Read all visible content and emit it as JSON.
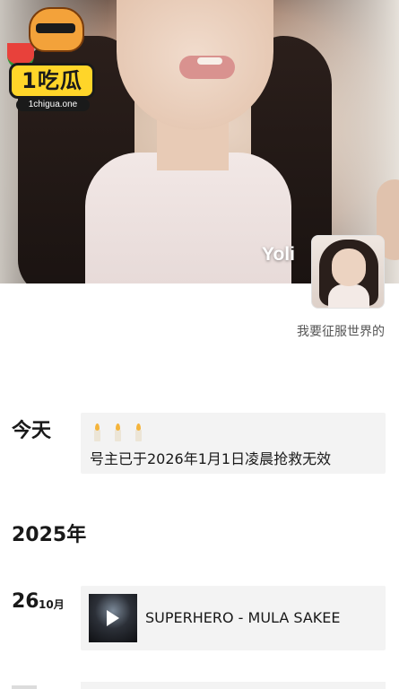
{
  "profile": {
    "name": "Yoli",
    "signature": "我要征服世界的"
  },
  "watermark": {
    "badge_text": "1吃瓜",
    "url": "1chigua.one"
  },
  "timeline": {
    "today": {
      "label": "今天",
      "icons": [
        "candle-icon",
        "candle-icon",
        "candle-icon"
      ],
      "text": "号主已于2026年1月1日凌晨抢救无效"
    },
    "year": {
      "label": "2025年"
    },
    "entries": [
      {
        "day": "26",
        "month": "10月",
        "type": "music",
        "title": "SUPERHERO - MULA SAKEE"
      }
    ]
  },
  "colors": {
    "background": "#ffffff",
    "card": "#f3f3f3",
    "text": "#191919",
    "muted": "#555555"
  }
}
